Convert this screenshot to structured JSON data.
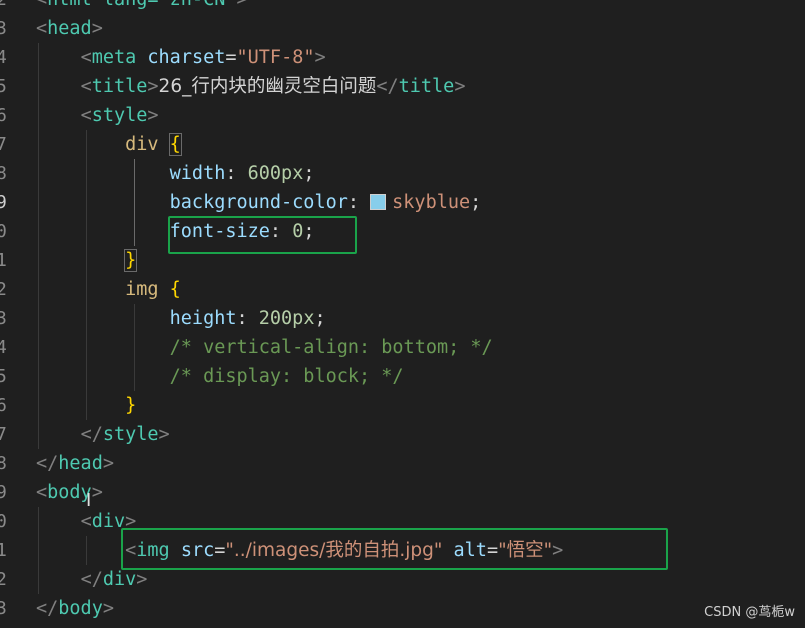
{
  "gutter_numbers": [
    "2",
    "3",
    "4",
    "5",
    "6",
    "7",
    "8",
    "9",
    "0",
    "1",
    "2",
    "3",
    "4",
    "5",
    "6",
    "7",
    "8",
    "9",
    "0",
    "1",
    "2",
    "3"
  ],
  "code": {
    "l0_text": "html lang=\"zh-CN\"",
    "l1_tag": "head",
    "l2_tag": "meta",
    "l2_attr": "charset",
    "l2_val": "\"UTF-8\"",
    "l3_tag": "title",
    "l3_text": "26_行内块的幽灵空白问题",
    "l3_close": "title",
    "l4_tag": "style",
    "l5_selector": "div",
    "l5_brace": "{",
    "l6_prop": "width",
    "l6_val": "600px",
    "l7_prop": "background-color",
    "l7_val": "skyblue",
    "l8_prop": "font-size",
    "l8_val": "0",
    "l9_brace": "}",
    "l10_selector": "img",
    "l10_brace": "{",
    "l11_prop": "height",
    "l11_val": "200px",
    "l12_comment": "/* vertical-align: bottom; */",
    "l13_comment": "/* display: block; */",
    "l14_brace": "}",
    "l15_close": "style",
    "l16_close": "head",
    "l17_tag": "body",
    "l18_tag": "div",
    "l19_tag": "img",
    "l19_attr_src": "src",
    "l19_src_val": "\"../images/我的自拍.jpg\"",
    "l19_attr_alt": "alt",
    "l19_alt_val": "\"悟空\"",
    "l20_close": "div",
    "l21_close": "body"
  },
  "colors": {
    "background": "#1f1f1f",
    "highlight_box": "#1aa34a",
    "swatch": "#87ceeb"
  },
  "watermark": "CSDN @茑栀w"
}
